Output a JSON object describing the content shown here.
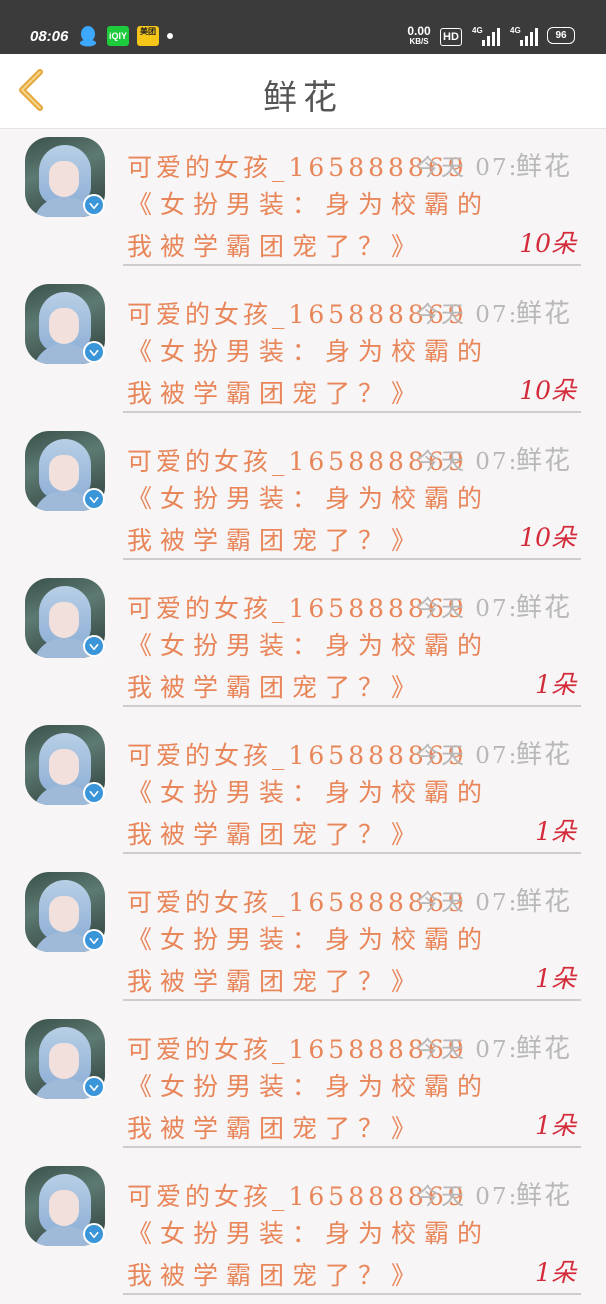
{
  "status_bar": {
    "time": "08:06",
    "apps": [
      "qq-icon",
      "iqiyi-icon",
      "meituan-icon"
    ],
    "iqiyi_label": "iQIY",
    "meituan_label": "美团",
    "net_speed": "0.00",
    "net_unit": "KB/S",
    "hd": "HD",
    "sig1": "4G",
    "sig2": "4G",
    "battery": "96"
  },
  "header": {
    "title": "鲜花"
  },
  "items": [
    {
      "user": "可爱的女孩_165888869",
      "time": "今天 07:26",
      "kind": "鲜花",
      "book": "《女扮男装：身为校霸的我被学霸团宠了？》",
      "count": "10朵"
    },
    {
      "user": "可爱的女孩_165888869",
      "time": "今天 07:26",
      "kind": "鲜花",
      "book": "《女扮男装：身为校霸的我被学霸团宠了？》",
      "count": "10朵"
    },
    {
      "user": "可爱的女孩_165888869",
      "time": "今天 07:26",
      "kind": "鲜花",
      "book": "《女扮男装：身为校霸的我被学霸团宠了？》",
      "count": "10朵"
    },
    {
      "user": "可爱的女孩_165888869",
      "time": "今天 07:26",
      "kind": "鲜花",
      "book": "《女扮男装：身为校霸的我被学霸团宠了？》",
      "count": "1朵"
    },
    {
      "user": "可爱的女孩_165888869",
      "time": "今天 07:26",
      "kind": "鲜花",
      "book": "《女扮男装：身为校霸的我被学霸团宠了？》",
      "count": "1朵"
    },
    {
      "user": "可爱的女孩_165888869",
      "time": "今天 07:26",
      "kind": "鲜花",
      "book": "《女扮男装：身为校霸的我被学霸团宠了？》",
      "count": "1朵"
    },
    {
      "user": "可爱的女孩_165888869",
      "time": "今天 07:26",
      "kind": "鲜花",
      "book": "《女扮男装：身为校霸的我被学霸团宠了？》",
      "count": "1朵"
    },
    {
      "user": "可爱的女孩_165888869",
      "time": "今天 07:26",
      "kind": "鲜花",
      "book": "《女扮男装：身为校霸的我被学霸团宠了？》",
      "count": "1朵"
    }
  ],
  "colors": {
    "accent_orange": "#e8865a",
    "count_red": "#d42b3a",
    "muted": "#b8b8b8",
    "back_arrow": "#e6a63a"
  }
}
